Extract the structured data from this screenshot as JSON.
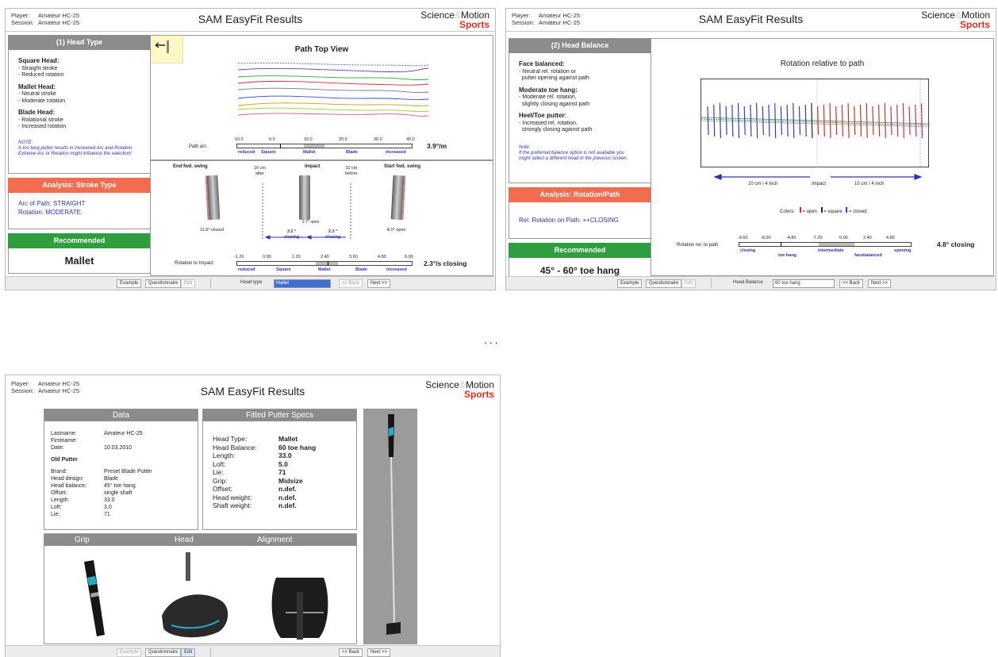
{
  "common": {
    "player_key": "Player:",
    "session_key": "Session:",
    "player": "Amateur HC-25",
    "session": "Amateur HC-25",
    "title": "SAM EasyFit Results",
    "brand_science": "Science",
    "brand_amp": "&",
    "brand_motion": "Motion",
    "brand_sports": "Sports",
    "btn_example": "Example",
    "btn_questionnaire": "Questionnaire",
    "btn_edit": "Edit",
    "btn_back": "<< Back",
    "btn_next": "Next >>"
  },
  "screen1": {
    "panel_title": "(1) Head Type",
    "square_title": "Square Head:",
    "square_items": [
      "- Straight stroke",
      "- Reduced rotation"
    ],
    "mallet_title": "Mallet Head:",
    "mallet_items": [
      "- Neutral stroke",
      "- Moderate rotation"
    ],
    "blade_title": "Blade Head:",
    "blade_items": [
      "- Rotational stroke",
      "- Increased rotation"
    ],
    "note": "NOTE:\nA too long putter results in increased Arc and Rotation.\nExtreme Arc or Rotation might influence the selection!",
    "analysis_title": "Analysis: Stroke Type",
    "analysis_line1": "Arc of Path: STRAIGHT",
    "analysis_line2": "Rotation: MODERATE.",
    "recommended_title": "Recommended",
    "recommended_value": "Mallet",
    "chart_title": "Path Top View",
    "path_arc_label": "Path arc",
    "path_arc_ticks": [
      "-10.0",
      "0.0",
      "10.0",
      "20.0",
      "30.0",
      "40.0"
    ],
    "path_arc_zones": [
      "reduced",
      "Square",
      "Mallet",
      "Blade",
      "increased"
    ],
    "path_arc_value": "3.9°/m",
    "end_swing": "End fwd. swing",
    "after": "10 cm\nafter",
    "impact": "Impact",
    "before": "10 cm\nbefore",
    "start_swing": "Start fwd. swing",
    "end_angle": "11.6° closed",
    "impact_angle": "2.7° open",
    "start_angle": "8.0° open",
    "closing_left": "3.2 °\nclosing",
    "closing_right": "2.3 °\nclosing",
    "rotation_label": "Rotation to Impact",
    "rotation_ticks": [
      "-1.20",
      "0.00",
      "1.20",
      "2.40",
      "3.60",
      "4.80",
      "6.00"
    ],
    "rotation_zones": [
      "reduced",
      "Square",
      "Mallet",
      "Blade",
      "increased"
    ],
    "rotation_value": "2.3°/s closing",
    "head_type_label": "Head type",
    "head_type_value": "Mallet"
  },
  "screen2": {
    "panel_title": "(2) Head Balance",
    "face_title": "Face balanced:",
    "face_items": [
      "- Neutral rel. rotation or",
      "  putter opening against path"
    ],
    "toe_title": "Moderate toe hang:",
    "toe_items": [
      "- Moderate rel. rotation,",
      "  slightly closing against path"
    ],
    "heel_title": "Heel/Toe putter:",
    "heel_items": [
      "- Increased rel. rotation,",
      "  strongly closing against path"
    ],
    "note": "Note:\nIf the preferred balance option is not available you\nmight select a different head in the previous screen.",
    "analysis_title": "Analysis: Rotation/Path",
    "analysis_line1": "Rel. Rotation on Path: ++CLOSING",
    "recommended_title": "Recommended",
    "recommended_value": "45° - 60° toe hang",
    "chart_title": "Rotation relative to path",
    "left_range": "10 cm / 4 inch",
    "impact": "Impact",
    "right_range": "10 cm / 4 inch",
    "colors_label": "Colors:",
    "legend_open": "= open",
    "legend_square": "= square",
    "legend_closed": "= closed",
    "rot_label": "Rotation rel. to path",
    "rot_ticks": [
      "-9.60",
      "-8.00",
      "-4.80",
      "-7.20",
      "0.00",
      "2.40",
      "4.80"
    ],
    "rot_zones": [
      "closing",
      "toe hang",
      "intermediate",
      "facebalanced",
      "opening"
    ],
    "rot_value": "4.8° closing",
    "head_balance_label": "Head Balance",
    "head_balance_value": "60 toe hang"
  },
  "ellipsis": "...",
  "screen3": {
    "data_title": "Data",
    "lastname_k": "Lastname:",
    "lastname_v": "Amateur HC-25",
    "firstname_k": "Firstname:",
    "firstname_v": "",
    "date_k": "Date:",
    "date_v": "10.03.2010",
    "old_putter": "Old Putter",
    "brand_k": "Brand:",
    "brand_v": "Preset Blade Putter",
    "design_k": "Head design:",
    "design_v": "Blade",
    "balance_k": "Head balance:",
    "balance_v": "45° toe hang",
    "offset_k": "Offset:",
    "offset_v": "single shaft",
    "length_k": "Length:",
    "length_v": "33.0",
    "loft_k": "Loft:",
    "loft_v": "3.0",
    "lie_k": "Lie:",
    "lie_v": "71",
    "specs_title": "Fitted Putter Specs",
    "specs": [
      {
        "k": "Head Type:",
        "v": "Mallet"
      },
      {
        "k": "Head Balance:",
        "v": "60 toe hang"
      },
      {
        "k": "Length:",
        "v": "33.0"
      },
      {
        "k": "Loft:",
        "v": "5.0"
      },
      {
        "k": "Lie:",
        "v": "71"
      },
      {
        "k": "Grip:",
        "v": "Midsize"
      },
      {
        "k": "Offset:",
        "v": "n.def."
      },
      {
        "k": "Head weight:",
        "v": "n.def."
      },
      {
        "k": "Shaft weight:",
        "v": "n.def."
      }
    ],
    "grip_title": "Grip",
    "head_title": "Head",
    "alignment_title": "Alignment"
  }
}
